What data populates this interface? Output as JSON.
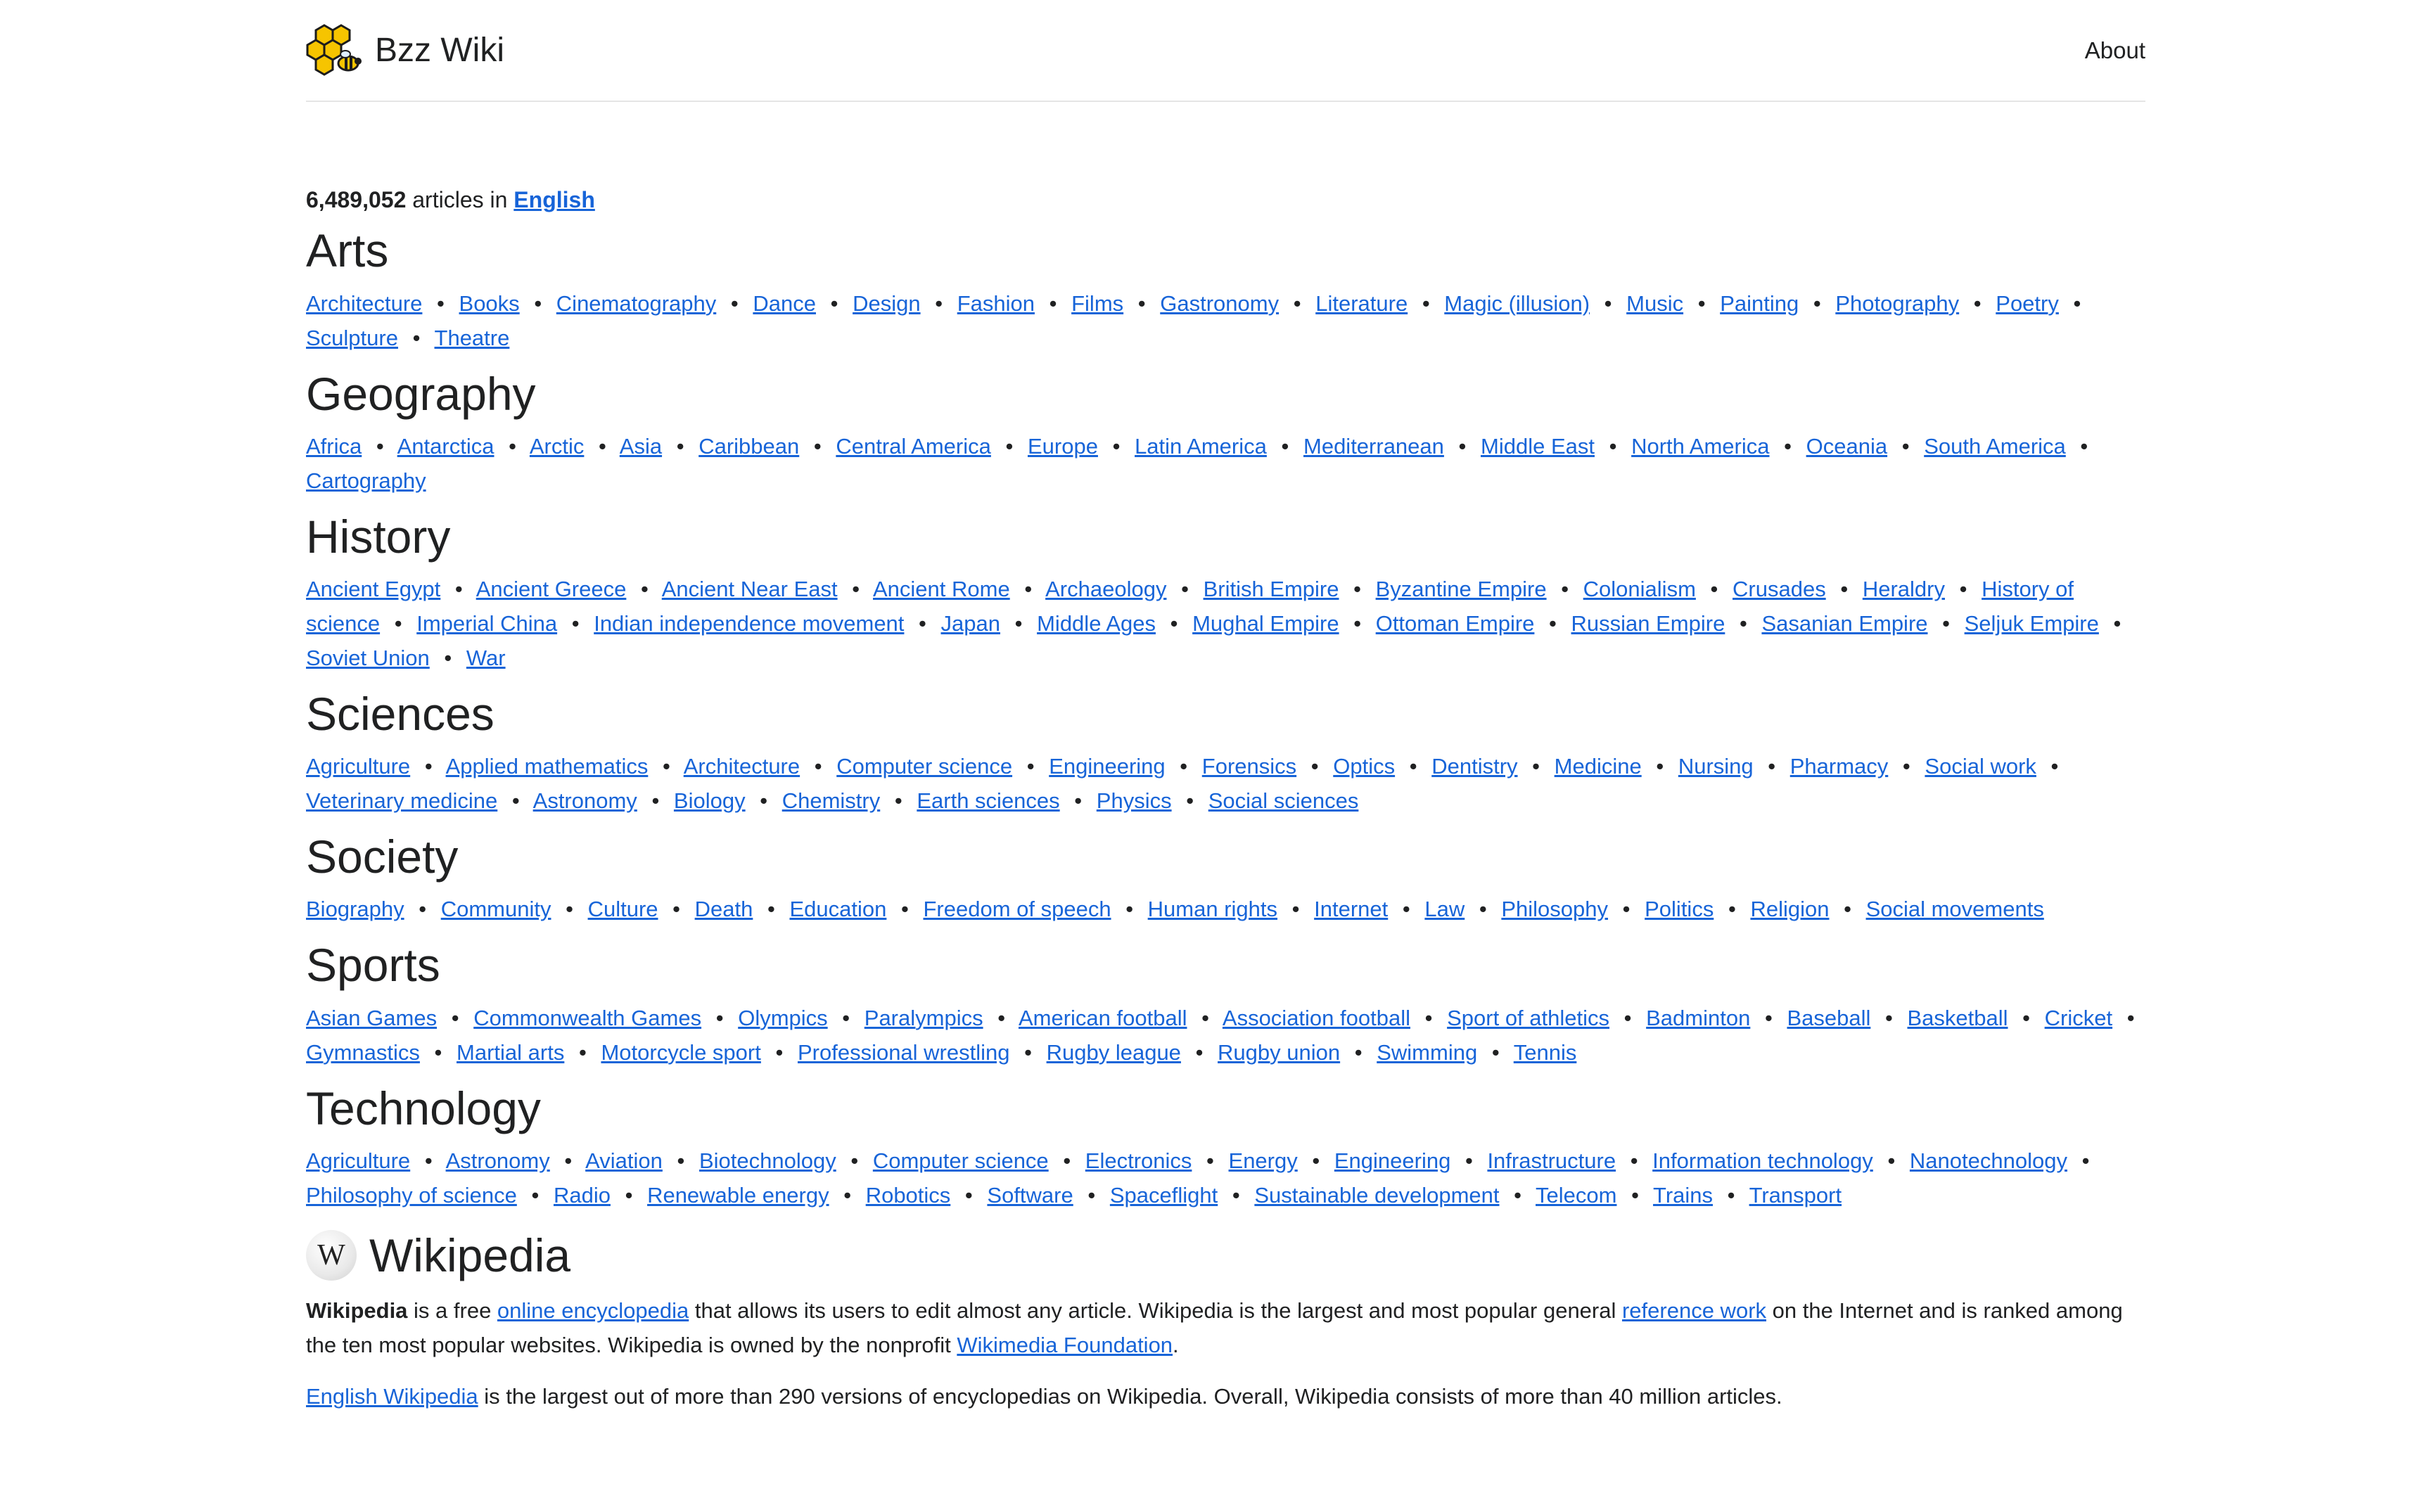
{
  "brand": {
    "name": "Bzz Wiki"
  },
  "nav": {
    "about": "About"
  },
  "stats": {
    "count": "6,489,052",
    "middle": " articles in ",
    "language": "English"
  },
  "sections": [
    {
      "title": "Arts",
      "links": [
        "Architecture",
        "Books",
        "Cinematography",
        "Dance",
        "Design",
        "Fashion",
        "Films",
        "Gastronomy",
        "Literature",
        "Magic (illusion)",
        "Music",
        "Painting",
        "Photography",
        "Poetry",
        "Sculpture",
        "Theatre"
      ]
    },
    {
      "title": "Geography",
      "links": [
        "Africa",
        "Antarctica",
        "Arctic",
        "Asia",
        "Caribbean",
        "Central America",
        "Europe",
        "Latin America",
        "Mediterranean",
        "Middle East",
        "North America",
        "Oceania",
        "South America",
        "Cartography"
      ]
    },
    {
      "title": "History",
      "links": [
        "Ancient Egypt",
        "Ancient Greece",
        "Ancient Near East",
        "Ancient Rome",
        "Archaeology",
        "British Empire",
        "Byzantine Empire",
        "Colonialism",
        "Crusades",
        "Heraldry",
        "History of science",
        "Imperial China",
        "Indian independence movement",
        "Japan",
        "Middle Ages",
        "Mughal Empire",
        "Ottoman Empire",
        "Russian Empire",
        "Sasanian Empire",
        "Seljuk Empire",
        "Soviet Union",
        "War"
      ]
    },
    {
      "title": "Sciences",
      "links": [
        "Agriculture",
        "Applied mathematics",
        "Architecture",
        "Computer science",
        "Engineering",
        "Forensics",
        "Optics",
        "Dentistry",
        "Medicine",
        "Nursing",
        "Pharmacy",
        "Social work",
        "Veterinary medicine",
        "Astronomy",
        "Biology",
        "Chemistry",
        "Earth sciences",
        "Physics",
        "Social sciences"
      ]
    },
    {
      "title": "Society",
      "links": [
        "Biography",
        "Community",
        "Culture",
        "Death",
        "Education",
        "Freedom of speech",
        "Human rights",
        "Internet",
        "Law",
        "Philosophy",
        "Politics",
        "Religion",
        "Social movements"
      ]
    },
    {
      "title": "Sports",
      "links": [
        "Asian Games",
        "Commonwealth Games",
        "Olympics",
        "Paralympics",
        "American football",
        "Association football",
        "Sport of athletics",
        "Badminton",
        "Baseball",
        "Basketball",
        "Cricket",
        "Gymnastics",
        "Martial arts",
        "Motorcycle sport",
        "Professional wrestling",
        "Rugby league",
        "Rugby union",
        "Swimming",
        "Tennis"
      ]
    },
    {
      "title": "Technology",
      "links": [
        "Agriculture",
        "Astronomy",
        "Aviation",
        "Biotechnology",
        "Computer science",
        "Electronics",
        "Energy",
        "Engineering",
        "Infrastructure",
        "Information technology",
        "Nanotechnology",
        "Philosophy of science",
        "Radio",
        "Renewable energy",
        "Robotics",
        "Software",
        "Spaceflight",
        "Sustainable development",
        "Telecom",
        "Trains",
        "Transport"
      ]
    }
  ],
  "wikipedia": {
    "logo_glyph": "W",
    "title": "Wikipedia",
    "p1": {
      "bold": "Wikipedia",
      "t1": " is a free ",
      "link1": "online encyclopedia",
      "t2": " that allows its users to edit almost any article. Wikipedia is the largest and most popular general ",
      "link2": "reference work",
      "t3": " on the Internet and is ranked among the ten most popular websites. Wikipedia is owned by the nonprofit ",
      "link3": "Wikimedia Foundation",
      "t4": "."
    },
    "p2": {
      "link1": "English Wikipedia",
      "t1": " is the largest out of more than 290 versions of encyclopedias on Wikipedia. Overall, Wikipedia consists of more than 40 million articles."
    }
  },
  "colors": {
    "link": "#1764d8",
    "text": "#202122",
    "divider": "#e5e5e5"
  },
  "icons": {
    "logo": "honeycomb-bee-icon",
    "wiki": "wikipedia-globe-icon"
  }
}
